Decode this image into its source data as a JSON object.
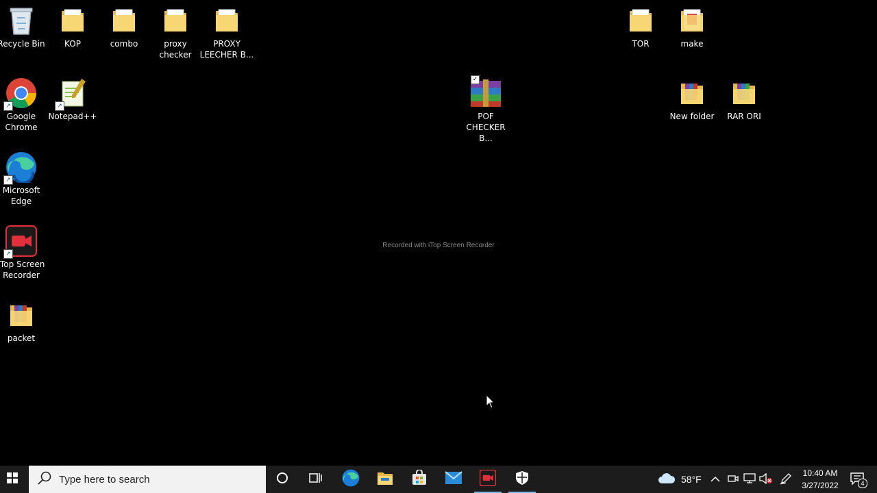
{
  "desktop": {
    "icons": [
      {
        "label": "Recycle Bin"
      },
      {
        "label": "KOP"
      },
      {
        "label": "combo"
      },
      {
        "label": "proxy checker"
      },
      {
        "label": "PROXY LEECHER B..."
      },
      {
        "label": "TOR"
      },
      {
        "label": "make"
      },
      {
        "label": "Google Chrome"
      },
      {
        "label": "Notepad++"
      },
      {
        "label": "POF CHECKER B..."
      },
      {
        "label": "New folder"
      },
      {
        "label": "RAR ORI"
      },
      {
        "label": "Microsoft Edge"
      },
      {
        "label": "iTop Screen Recorder"
      },
      {
        "label": "packet"
      }
    ],
    "watermark": "Recorded with iTop Screen Recorder"
  },
  "taskbar": {
    "search_placeholder": "Type here to search",
    "weather_temp": "58°F",
    "time": "10:40 AM",
    "date": "3/27/2022",
    "notification_count": "4"
  }
}
